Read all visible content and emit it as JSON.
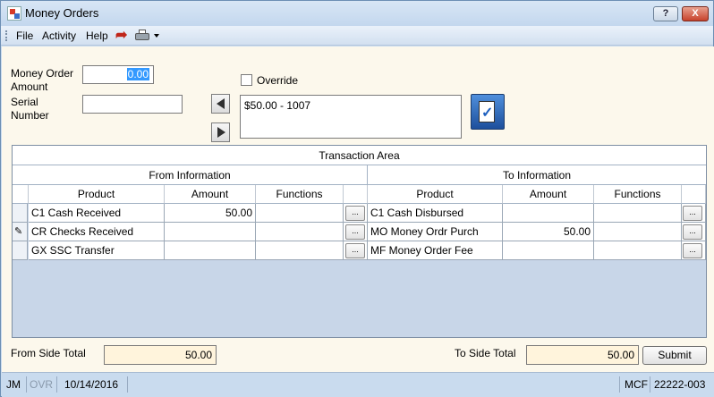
{
  "window": {
    "title": "Money Orders",
    "help_label": "?",
    "close_label": "X"
  },
  "menu": {
    "items": [
      "File",
      "Activity",
      "Help"
    ],
    "redo_icon": "redo-arrow-icon",
    "print_icon": "printer-icon"
  },
  "form": {
    "money_order_amount_label": "Money Order\nAmount",
    "money_order_amount_line1": "Money Order",
    "money_order_amount_line2": "Amount",
    "money_order_amount_value": "0.00",
    "serial_label_line1": "Serial",
    "serial_label_line2": "Number",
    "serial_value": "",
    "override_label": "Override",
    "override_checked": false,
    "list_items": [
      "$50.00 - 1007"
    ]
  },
  "grid": {
    "caption": "Transaction Area",
    "from_header": "From Information",
    "to_header": "To Information",
    "columns": {
      "product": "Product",
      "amount": "Amount",
      "functions": "Functions"
    },
    "ellipsis": "...",
    "rows": [
      {
        "from_product": "C1 Cash Received",
        "from_amount": "50.00",
        "to_product": "C1 Cash Disbursed",
        "to_amount": "",
        "selected": false
      },
      {
        "from_product": "CR Checks Received",
        "from_amount": "",
        "to_product": "MO Money Ordr Purch",
        "to_amount": "50.00",
        "selected": true
      },
      {
        "from_product": "GX SSC Transfer",
        "from_amount": "",
        "to_product": "MF Money Order Fee",
        "to_amount": "",
        "selected": false
      }
    ]
  },
  "totals": {
    "from_label": "From Side Total",
    "from_value": "50.00",
    "to_label": "To Side Total",
    "to_value": "50.00",
    "submit_label": "Submit"
  },
  "status": {
    "user": "JM",
    "ovr": "OVR",
    "date": "10/14/2016",
    "mcf": "MCF",
    "code": "22222-003"
  },
  "colors": {
    "chrome": "#c9dbee",
    "panel": "#fcf8ec",
    "grid_bg": "#c8d6e8",
    "total_bg": "#fff4dc",
    "selection": "#3399ff"
  }
}
